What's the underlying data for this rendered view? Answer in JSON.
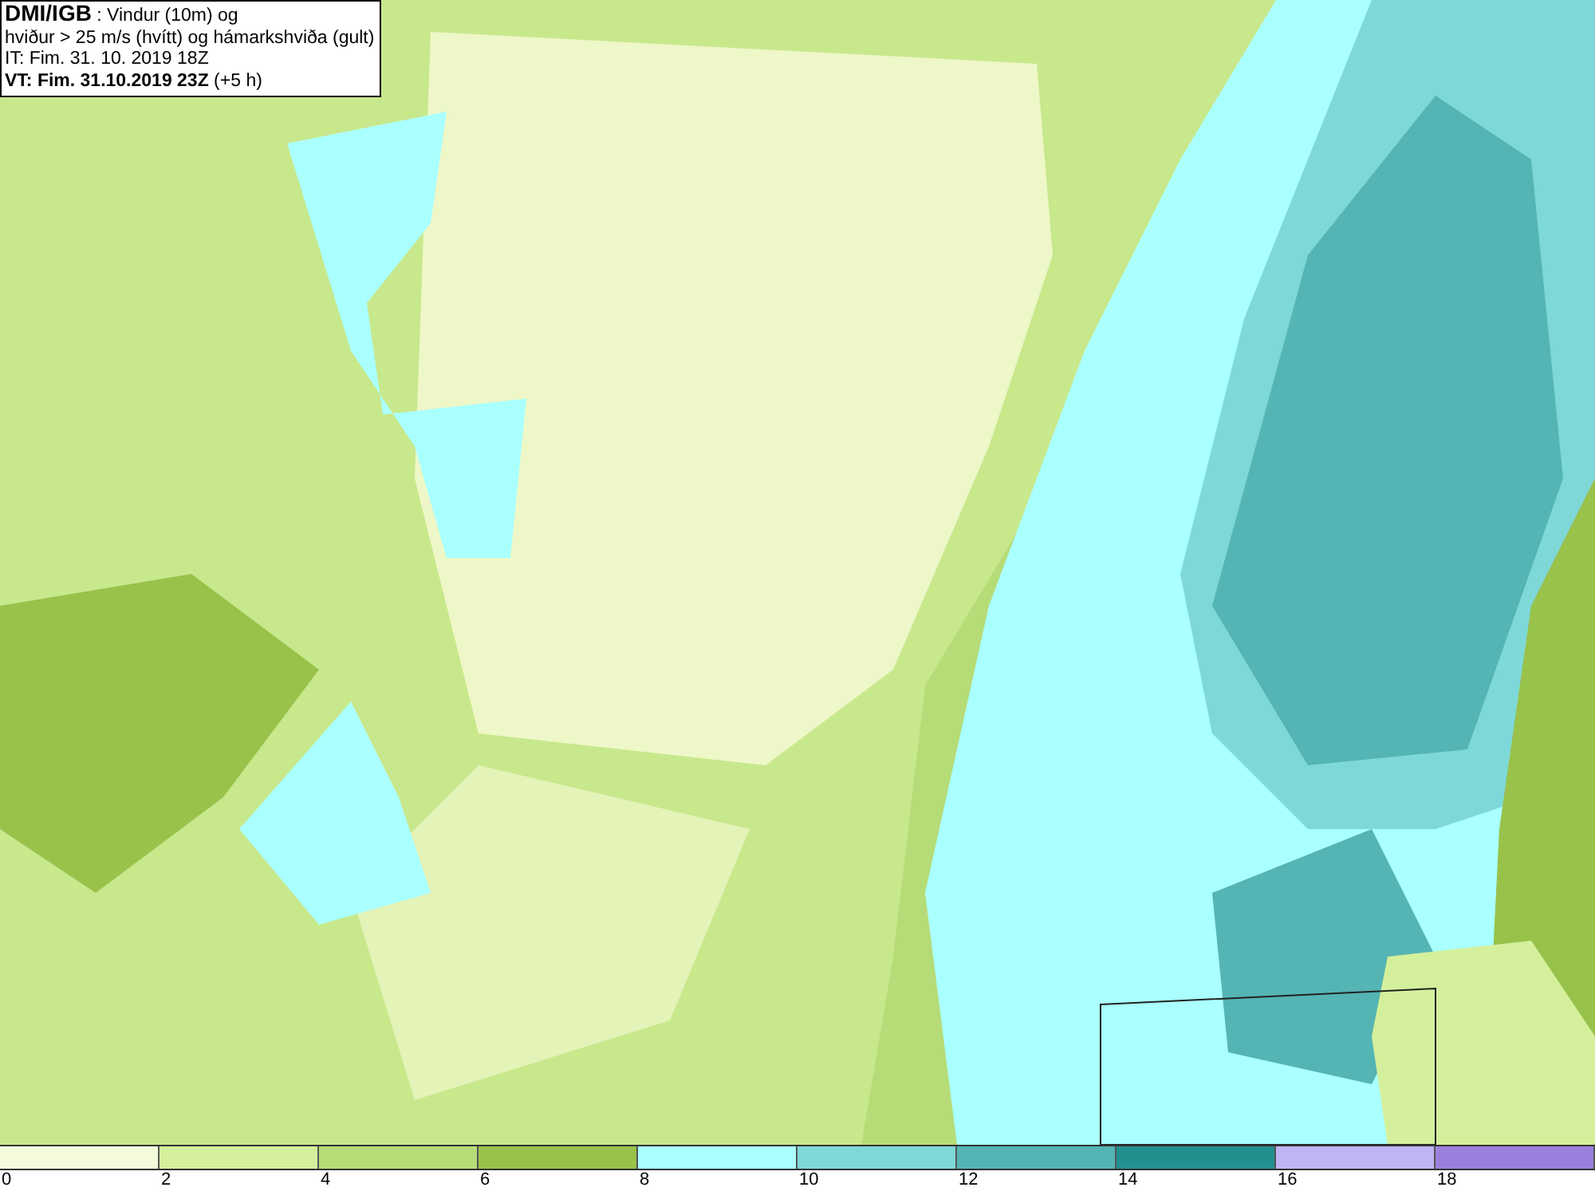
{
  "title_box": {
    "lines": [
      "**DMI/IGB** : Vindur (10m) og",
      "hviður > 25 m/s (hvítt) og hámarkshviða (gult)",
      "IT: Fim. 31. 10. 2019 18Z",
      "**VT: Fim. 31.10.2019 23Z** (+5 h)"
    ]
  },
  "legend": {
    "bins": [
      {
        "color": "#f4fadc"
      },
      {
        "color": "#d4f09c"
      },
      {
        "color": "#b6dc78"
      },
      {
        "color": "#98c24a"
      },
      {
        "color": "#aaffff"
      },
      {
        "color": "#7fd8d8"
      },
      {
        "color": "#55b4b4"
      },
      {
        "color": "#239090"
      },
      {
        "color": "#c0b4f4"
      },
      {
        "color": "#9a80dc"
      }
    ],
    "ticks": [
      "0",
      "2",
      "4",
      "6",
      "8",
      "10",
      "12",
      "14",
      "16",
      "18"
    ]
  }
}
